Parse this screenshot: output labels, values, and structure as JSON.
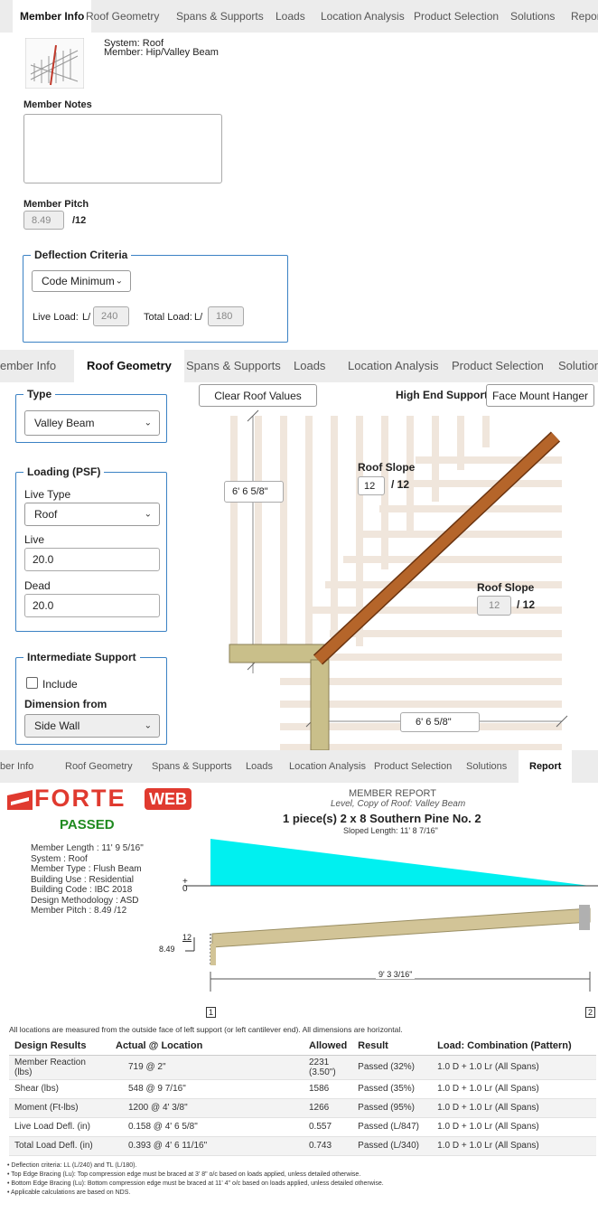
{
  "panel1": {
    "tabs": [
      "Member Info",
      "Roof Geometry",
      "Spans & Supports",
      "Loads",
      "Location Analysis",
      "Product Selection",
      "Solutions",
      "Report"
    ],
    "system": "System: Roof",
    "member": "Member: Hip/Valley Beam",
    "notes_label": "Member Notes",
    "pitch_label": "Member Pitch",
    "pitch_value": "8.49",
    "pitch_unit": "/12",
    "deflection_legend": "Deflection Criteria",
    "deflection_select": "Code Minimum",
    "live_label": "Live Load:",
    "l_prefix": "L/",
    "live_value": "240",
    "total_label": "Total Load:",
    "total_value": "180"
  },
  "panel2": {
    "tabs": [
      "ember Info",
      "Roof Geometry",
      "Spans & Supports",
      "Loads",
      "Location Analysis",
      "Product Selection",
      "Solutions"
    ],
    "type_legend": "Type",
    "type_value": "Valley Beam",
    "loading_legend": "Loading (PSF)",
    "live_type_label": "Live Type",
    "live_type_value": "Roof",
    "live_label": "Live",
    "live_value": "20.0",
    "dead_label": "Dead",
    "dead_value": "20.0",
    "intermediate_legend": "Intermediate Support",
    "include_label": "Include",
    "dimension_label": "Dimension from",
    "dimension_value": "Side Wall",
    "clear_button": "Clear Roof Values",
    "high_end_label": "High End Support",
    "high_end_value": "Face Mount Hanger",
    "roof_slope_label": "Roof Slope",
    "slope1": "12",
    "slope2": "12",
    "slope_unit": "/ 12",
    "dim_vertical": "6' 6 5/8\"",
    "dim_horizontal": "6' 6 5/8\""
  },
  "panel3": {
    "tabs": [
      "ber Info",
      "Roof Geometry",
      "Spans & Supports",
      "Loads",
      "Location Analysis",
      "Product Selection",
      "Solutions",
      "Report"
    ],
    "logo_forte": "FORTE",
    "logo_web": "WEB",
    "passed": "PASSED",
    "report_title": "MEMBER REPORT",
    "report_sub": "Level, Copy of Roof: Valley Beam",
    "report_member": "1 piece(s) 2 x 8 Southern Pine No. 2",
    "info": [
      "Member Length : 11' 9 5/16\"",
      "System : Roof",
      "Member Type : Flush Beam",
      "Building Use : Residential",
      "Building Code : IBC 2018",
      "Design Methodology : ASD",
      "Member Pitch : 8.49 /12"
    ],
    "sloped_length": "Sloped Length: 11' 8 7/16\"",
    "plus": "+",
    "zero": "0",
    "pitch_rise": "12",
    "pitch_run": "8.49",
    "span": "9' 3 3/16\"",
    "support1": "1",
    "support2": "2",
    "locations_note": "All locations are measured from the outside face of left support (or left cantilever end). All dimensions are horizontal.",
    "table_headers": [
      "Design Results",
      "Actual @ Location",
      "Allowed",
      "Result",
      "Load: Combination (Pattern)"
    ],
    "table_rows": [
      [
        "Member Reaction (lbs)",
        "719 @ 2\"",
        "2231 (3.50\")",
        "Passed (32%)",
        "1.0 D + 1.0 Lr (All Spans)"
      ],
      [
        "Shear (lbs)",
        "548 @ 9 7/16\"",
        "1586",
        "Passed (35%)",
        "1.0 D + 1.0 Lr (All Spans)"
      ],
      [
        "Moment (Ft-lbs)",
        "1200 @ 4' 3/8\"",
        "1266",
        "Passed (95%)",
        "1.0 D + 1.0 Lr (All Spans)"
      ],
      [
        "Live Load Defl. (in)",
        "0.158 @ 4' 6 5/8\"",
        "0.557",
        "Passed (L/847)",
        "1.0 D + 1.0 Lr (All Spans)"
      ],
      [
        "Total Load Defl. (in)",
        "0.393 @ 4' 6 11/16\"",
        "0.743",
        "Passed (L/340)",
        "1.0 D + 1.0 Lr (All Spans)"
      ]
    ],
    "notes": [
      "Deflection criteria: LL (L/240) and TL (L/180).",
      "Top Edge Bracing (Lu): Top compression edge must be braced at 3' 8\" o/c based on loads applied, unless detailed otherwise.",
      "Bottom Edge Bracing (Lu): Bottom compression edge must be braced at 11' 4\" o/c based on loads applied, unless detailed otherwise.",
      "Applicable calculations are based on NDS."
    ]
  },
  "colors": {
    "accent": "#3b82c4",
    "forte_red": "#e03a2f",
    "passed_green": "#1f8a1f",
    "load_cyan": "#00f0f0",
    "beam_tan": "#d2c497",
    "rafter_brown": "#a0522d"
  }
}
